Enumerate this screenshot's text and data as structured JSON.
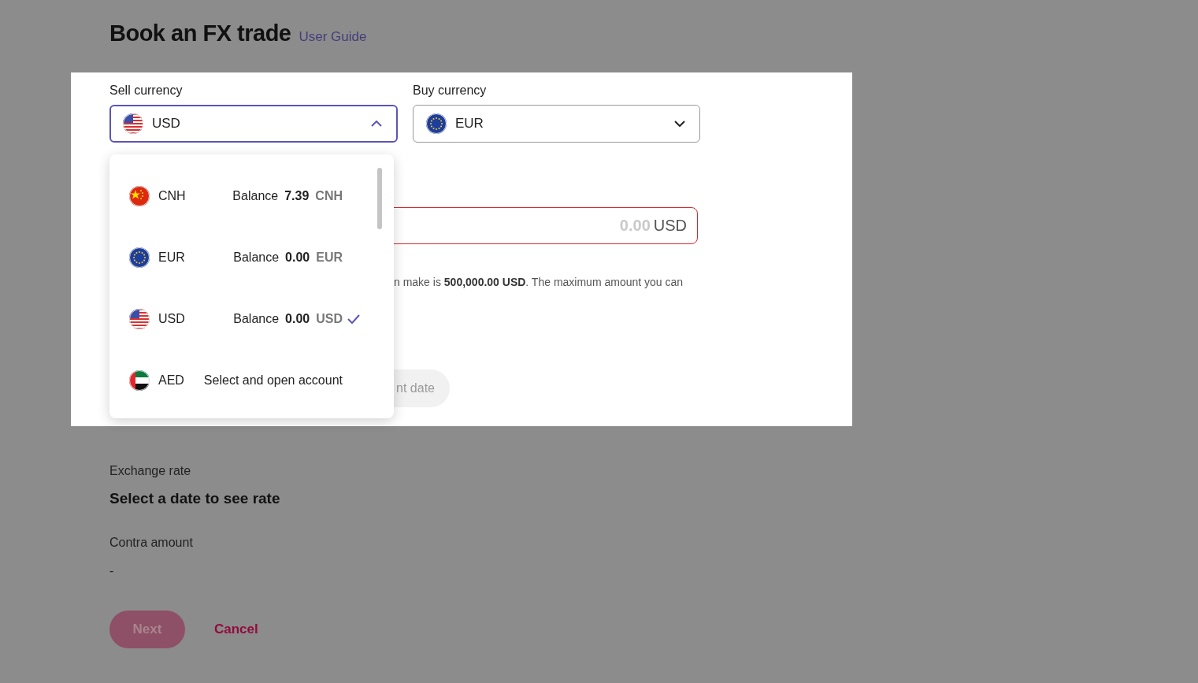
{
  "header": {
    "title": "Book an FX trade",
    "link": "User Guide"
  },
  "sell": {
    "label": "Sell currency",
    "value": "USD",
    "expanded": true
  },
  "buy": {
    "label": "Buy currency",
    "value": "EUR",
    "expanded": false
  },
  "amount": {
    "placeholder": "0.00",
    "suffix": "USD",
    "invalid": true
  },
  "help_text": "n make is **500,000.00 USD**. The maximum amount you can",
  "date_button": {
    "label": "nt date",
    "disabled": true
  },
  "dropdown": {
    "items": [
      {
        "kind": "account",
        "code": "CNH",
        "balance_label": "Balance",
        "amount": "7.39",
        "currency": "CNH",
        "selected": false
      },
      {
        "kind": "account",
        "code": "EUR",
        "balance_label": "Balance",
        "amount": "0.00",
        "currency": "EUR",
        "selected": false
      },
      {
        "kind": "account",
        "code": "USD",
        "balance_label": "Balance",
        "amount": "0.00",
        "currency": "USD",
        "selected": true
      },
      {
        "kind": "open",
        "code": "AED",
        "action": "Select and open account",
        "selected": false
      }
    ]
  },
  "exchange_rate": {
    "label": "Exchange rate",
    "value": "Select a date to see rate"
  },
  "contra_amount": {
    "label": "Contra amount",
    "value": "-"
  },
  "actions": {
    "next": {
      "label": "Next",
      "disabled": true
    },
    "cancel": "Cancel"
  }
}
